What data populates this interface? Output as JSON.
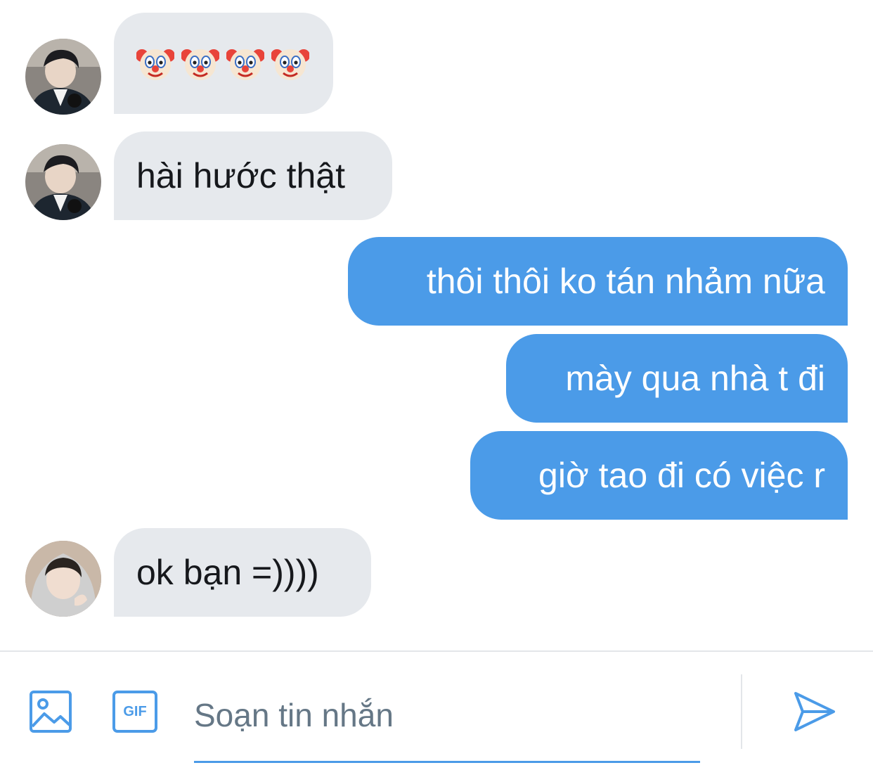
{
  "conversation": {
    "messages": [
      {
        "direction": "incoming",
        "avatar": "avatar-user-a",
        "content": [
          "clown-face-emoji",
          "clown-face-emoji",
          "clown-face-emoji",
          "clown-face-emoji"
        ]
      },
      {
        "direction": "incoming",
        "avatar": "avatar-user-a",
        "text": "hài hước thật"
      },
      {
        "direction": "outgoing",
        "text": "thôi thôi ko tán nhảm nữa"
      },
      {
        "direction": "outgoing",
        "text": "mày qua nhà t đi"
      },
      {
        "direction": "outgoing",
        "text": "giờ tao đi có việc r"
      },
      {
        "direction": "incoming",
        "avatar": "avatar-user-b",
        "text": "ok bạn =))))"
      }
    ]
  },
  "composer": {
    "placeholder": "Soạn tin nhắn",
    "value": "",
    "gif_label": "GIF",
    "icons": [
      "image-icon",
      "gif-icon",
      "send-icon"
    ]
  },
  "colors": {
    "accent": "#4b9be8",
    "incoming_bubble": "#e6e9ed",
    "outgoing_bubble": "#4b9be8",
    "placeholder": "#657786"
  }
}
